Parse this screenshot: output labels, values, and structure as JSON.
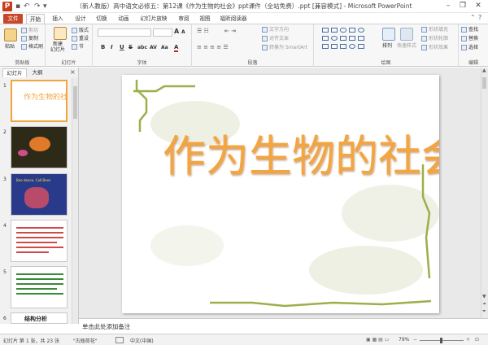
{
  "window": {
    "title": "（新人教版）高中语文必修五：第12课《作为生物的社会》ppt课件（全站免费）.ppt [兼容模式] - Microsoft PowerPoint",
    "app_icon": "P"
  },
  "tabs": [
    "文件",
    "开始",
    "插入",
    "设计",
    "切换",
    "动画",
    "幻灯片放映",
    "审阅",
    "视图",
    "福昕阅读器"
  ],
  "ribbon": {
    "clipboard": {
      "paste": "粘贴",
      "cut": "剪切",
      "copy": "复制",
      "format_painter": "格式刷",
      "label": "剪贴板"
    },
    "slides": {
      "new_slide": "新建\n幻灯片",
      "layout": "版式",
      "reset": "重设",
      "section": "节",
      "label": "幻灯片"
    },
    "font": {
      "size_up": "A",
      "size_down": "A",
      "label": "字体",
      "bold": "B",
      "italic": "I",
      "underline": "U",
      "strike": "S",
      "shadow": "abc",
      "spacing": "AV",
      "case": "Aa",
      "color": "A"
    },
    "paragraph": {
      "text_direction": "文字方向",
      "align_text": "对齐文本",
      "smartart": "转换为 SmartArt",
      "label": "段落"
    },
    "drawing": {
      "arrange": "排列",
      "quick_styles": "快速样式",
      "shape_fill": "形状填充",
      "shape_outline": "形状轮廓",
      "shape_effects": "形状效果",
      "label": "绘图"
    },
    "editing": {
      "find": "查找",
      "replace": "替换",
      "select": "选择",
      "label": "编辑"
    }
  },
  "left_panel": {
    "tabs": [
      "幻灯片",
      "大纲"
    ],
    "close": "×",
    "thumbs": [
      {
        "num": "1",
        "text": "作为生物的社会"
      },
      {
        "num": "2",
        "text": ""
      },
      {
        "num": "3",
        "text": "Bee dance, Call Bees"
      },
      {
        "num": "4",
        "text": ""
      },
      {
        "num": "5",
        "text": ""
      },
      {
        "num": "6",
        "text": "结构分析"
      }
    ]
  },
  "slide": {
    "title": "作为生物的社会"
  },
  "notes": {
    "placeholder": "单击此处添加备注"
  },
  "status": {
    "slide_info": "幻灯片 第 1 张，共 23 张",
    "theme": "\"古瓶荷花\"",
    "language": "中文(中国)",
    "zoom": "79%"
  },
  "colors": {
    "accent": "#c8472a",
    "title_orange": "#f2a540",
    "border_green": "#9ab04a"
  }
}
